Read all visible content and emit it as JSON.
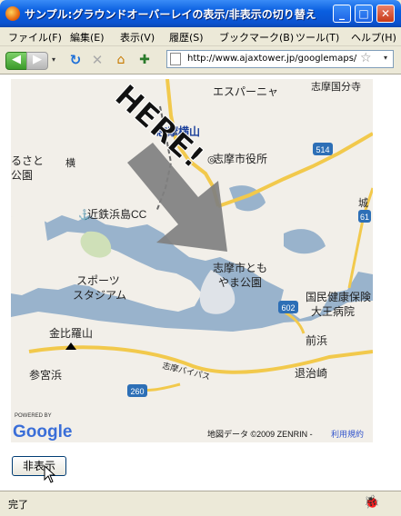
{
  "window": {
    "title": "サンプル:グラウンドオーバーレイの表示/非表示の切り替え",
    "buttons": [
      "_",
      "□",
      "✕"
    ]
  },
  "menu": [
    "ファイル(F)",
    "編集(E)",
    "表示(V)",
    "履歴(S)",
    "ブックマーク(B)",
    "ツール(T)",
    "ヘルプ(H)"
  ],
  "nav": {
    "back": "◀",
    "forward": "▶",
    "dropdown": "▾",
    "reload": "↻",
    "stop": "✕",
    "home": "⌂",
    "addon": "✚",
    "url": "http://www.ajaxtower.jp/googlemaps/",
    "star": "☆",
    "url_dropdown": "▾"
  },
  "map": {
    "overlay_text": "HERE!",
    "labels": {
      "espana": "エスパーニャ",
      "shima_yokoyama": "志摩横山",
      "shima_city_hall": "志摩市役所",
      "shima_nat_park": "志摩国分寺",
      "route_514": "514",
      "route_61": "61",
      "route_602": "602",
      "route_260": "260",
      "furusato": "るさと",
      "koen": "公園",
      "kintetsu": "近鉄浜島CC",
      "sports_stadium_1": "スポーツ",
      "sports_stadium_2": "スタジアム",
      "shima_tomoyama_1": "志摩市とも",
      "shima_tomoyama_2": "やま公園",
      "kokumin_hoken_1": "国民健康保険",
      "kokumin_hoken_2": "大王病院",
      "kanehira": "金比羅山",
      "maehama": "前浜",
      "sangenhama": "参宮浜",
      "taijizaki": "退治崎",
      "bypass": "志摩バイパス",
      "shiro": "城",
      "yoko": "横",
      "powered_by": "POWERED BY",
      "google": "Google",
      "attribution": "地図データ ©2009 ZENRIN - ",
      "terms": "利用規約"
    }
  },
  "toggle_button": "非表示",
  "status": "完了",
  "status_icon": "🐞"
}
